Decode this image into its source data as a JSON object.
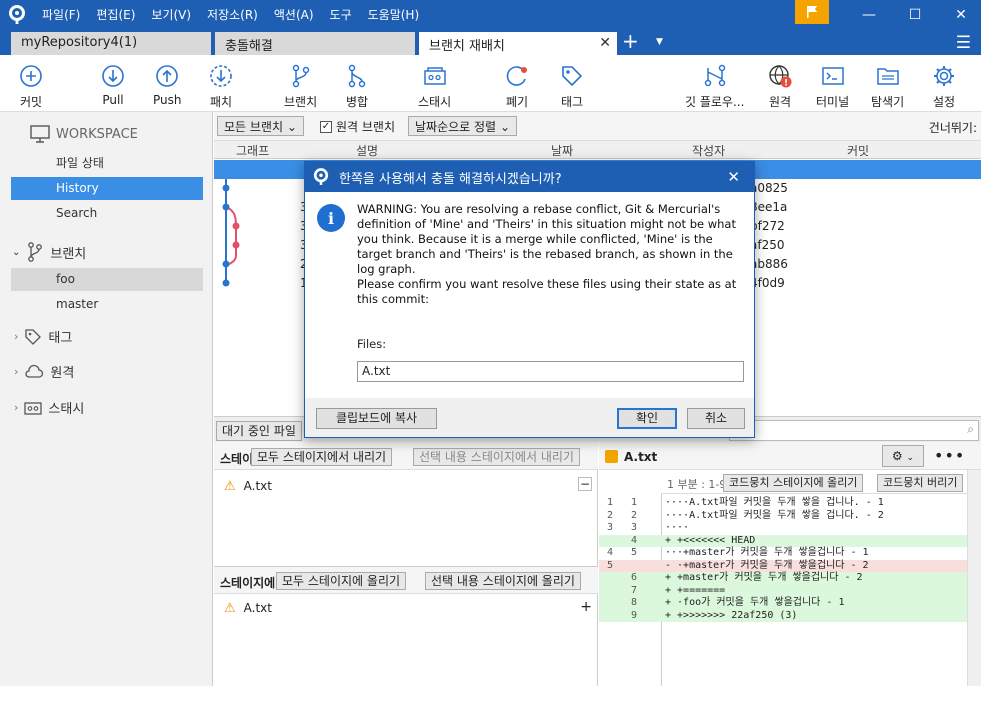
{
  "menu": [
    "파일(F)",
    "편집(E)",
    "보기(V)",
    "저장소(R)",
    "액션(A)",
    "도구",
    "도움말(H)"
  ],
  "tabs": [
    {
      "label": "myRepository4(1)"
    },
    {
      "label": "충돌해결"
    },
    {
      "label": "브랜치 재배치"
    }
  ],
  "tab_add": "+",
  "toolbar": {
    "commit": "커밋",
    "pull": "Pull",
    "push": "Push",
    "patch": "패치",
    "branch": "브랜치",
    "merge": "병합",
    "stash": "스태시",
    "discard": "폐기",
    "tag": "태그",
    "gitflow": "깃 플로우...",
    "remote": "원격",
    "terminal": "터미널",
    "explorer": "탐색기",
    "settings": "설정"
  },
  "sidebar": {
    "workspace": "WORKSPACE",
    "file_status": "파일 상태",
    "history": "History",
    "search": "Search",
    "branches": "브랜치",
    "branch_items": [
      "foo",
      "master"
    ],
    "tags": "태그",
    "remotes": "원격",
    "stashes": "스태시"
  },
  "filter": {
    "all_branches": "모든 브랜치",
    "remote_branches": "원격 브랜치",
    "sort": "날짜순으로 정렬",
    "skip": "건너뛰기:"
  },
  "columns": {
    "graph": "그래프",
    "desc": "설명",
    "date": "날짜",
    "author": "작성자",
    "commit": "커밋"
  },
  "commits": [
    {
      "desc": "",
      "hash": ""
    },
    {
      "desc": "",
      "hash": "a0825"
    },
    {
      "desc": "3",
      "hash": "8ee1a"
    },
    {
      "desc": "3",
      "hash": "bf272"
    },
    {
      "desc": "3",
      "hash": "af250"
    },
    {
      "desc": "2",
      "hash": "ab886"
    },
    {
      "desc": "1",
      "hash": "4f0d9"
    }
  ],
  "pending": {
    "label": "대기 중인 파일"
  },
  "staging": {
    "unstaged_label": "스테이",
    "unstage_all": "모두 스테이지에서 내리기",
    "unstage_selected": "선택 내용 스테이지에서 내리기",
    "staged_file": "A.txt",
    "unstaged_header": "스테이지에",
    "stage_all": "모두 스테이지에 올리기",
    "stage_selected": "선택 내용 스테이지에 올리기",
    "unstaged_file": "A.txt"
  },
  "diff": {
    "filename": "A.txt",
    "hunk": "1 부분 : 1-9",
    "stage_hunk": "코드뭉치 스테이지에 올리기",
    "discard_hunk": "코드뭉치 버리기",
    "lines": [
      {
        "n1": "1",
        "n2": "1",
        "text": "····A.txt파일 커밋을 두개 쌓을 겁니나. - 1",
        "type": ""
      },
      {
        "n1": "2",
        "n2": "2",
        "text": "····A.txt파일 커밋을 두개 쌓을 겁니다. - 2",
        "type": ""
      },
      {
        "n1": "3",
        "n2": "3",
        "text": "····",
        "type": ""
      },
      {
        "n1": "",
        "n2": "4",
        "text": "+ +<<<<<<< HEAD",
        "type": "add"
      },
      {
        "n1": "4",
        "n2": "5",
        "text": "···+master가 커밋을 두개 쌓을겁니다 - 1",
        "type": ""
      },
      {
        "n1": "5",
        "n2": "",
        "text": "- ·+master가 커밋을 두개 쌓을겁니다 - 2",
        "type": "del"
      },
      {
        "n1": "",
        "n2": "6",
        "text": "+ +master가 커밋을 두개 쌓을겁니다 - 2",
        "type": "add"
      },
      {
        "n1": "",
        "n2": "7",
        "text": "+ +=======",
        "type": "add"
      },
      {
        "n1": "",
        "n2": "8",
        "text": "+ ·foo가 커밋을 두개 쌓을겁니다 - 1",
        "type": "add"
      },
      {
        "n1": "",
        "n2": "9",
        "text": "+ +>>>>>>> 22af250 (3)",
        "type": "add"
      }
    ]
  },
  "dialog": {
    "title": "한쪽을 사용해서 충돌 해결하시겠습니까?",
    "message": "WARNING: You are resolving a rebase conflict, Git & Mercurial's definition of 'Mine' and 'Theirs' in this situation might not be what you think. Because it is a merge while conflicted, 'Mine' is the target branch and 'Theirs' is the rebased branch, as shown in the log graph.",
    "message2": "Please confirm you want resolve these files using their state as at this commit:",
    "files_label": "Files:",
    "files_value": "A.txt",
    "copy_button": "클립보드에 복사",
    "ok_button": "확인",
    "cancel_button": "취소"
  },
  "colors": {
    "accent": "#1e5fb3",
    "selection": "#3a8ee6",
    "flag": "#f5a300"
  }
}
